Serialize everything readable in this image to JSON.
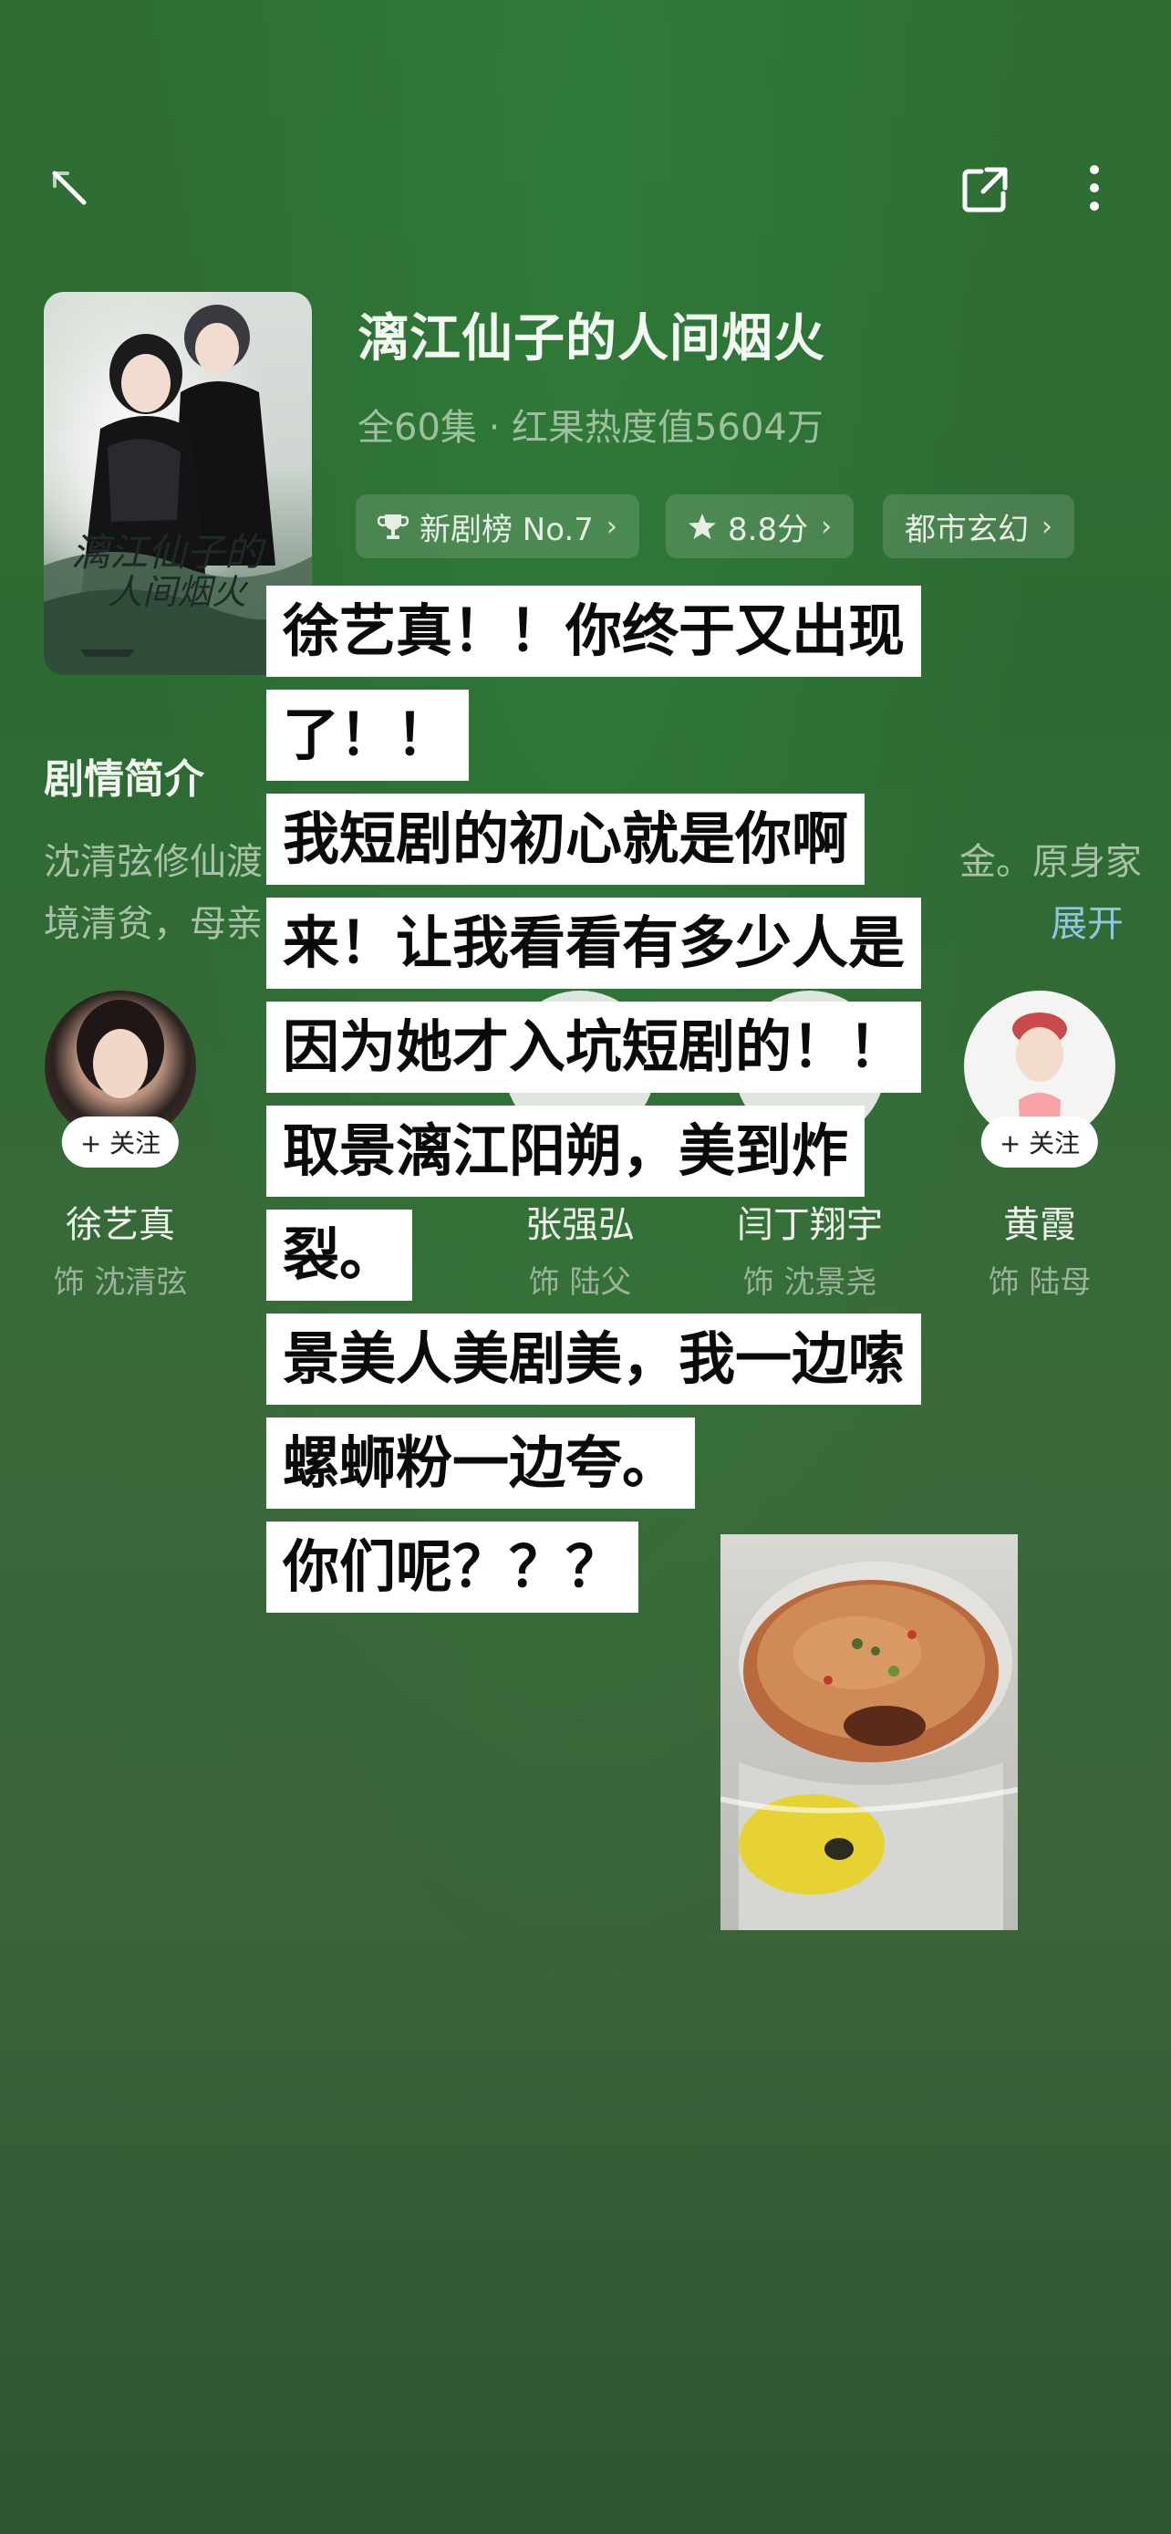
{
  "header": {
    "back_icon": "back-arrow-icon",
    "share_icon": "share-icon",
    "more_icon": "more-vertical-icon"
  },
  "drama": {
    "title": "漓江仙子的人间烟火",
    "meta": "全60集 · 红果热度值5604万",
    "tags": [
      {
        "label": "新剧榜 No.7",
        "icon": "trophy-icon"
      },
      {
        "label": "8.8分",
        "icon": "star-icon"
      },
      {
        "label": "都市玄幻",
        "icon": ""
      }
    ]
  },
  "synopsis": {
    "title": "剧情简介",
    "line1_start": "沈清弦修仙渡",
    "line1_end": "金。原身家",
    "line2_start": "境清贫，母亲",
    "expand_label": "展开"
  },
  "cast": [
    {
      "name": "徐艺真",
      "role": "饰 沈清弦",
      "follow": "+ 关注"
    },
    {
      "name": "张强弘",
      "role": "饰 陆父",
      "follow": ""
    },
    {
      "name": "闫丁翔宇",
      "role": "饰 沈景尧",
      "follow": ""
    },
    {
      "name": "黄霞",
      "role": "饰 陆母",
      "follow": "+ 关注"
    }
  ],
  "captions": [
    "徐艺真！！你终于又出现",
    "了！！",
    "我短剧的初心就是你啊",
    "来！让我看看有多少人是",
    "因为她才入坑短剧的！！",
    "取景漓江阳朔，美到炸",
    "裂。",
    "景美人美剧美，我一边嗦",
    "螺蛳粉一边夸。",
    "你们呢？？？"
  ],
  "colors": {
    "background": "#2e6e34",
    "caption_bg": "#ffffff",
    "expand": "#8fc7de"
  }
}
